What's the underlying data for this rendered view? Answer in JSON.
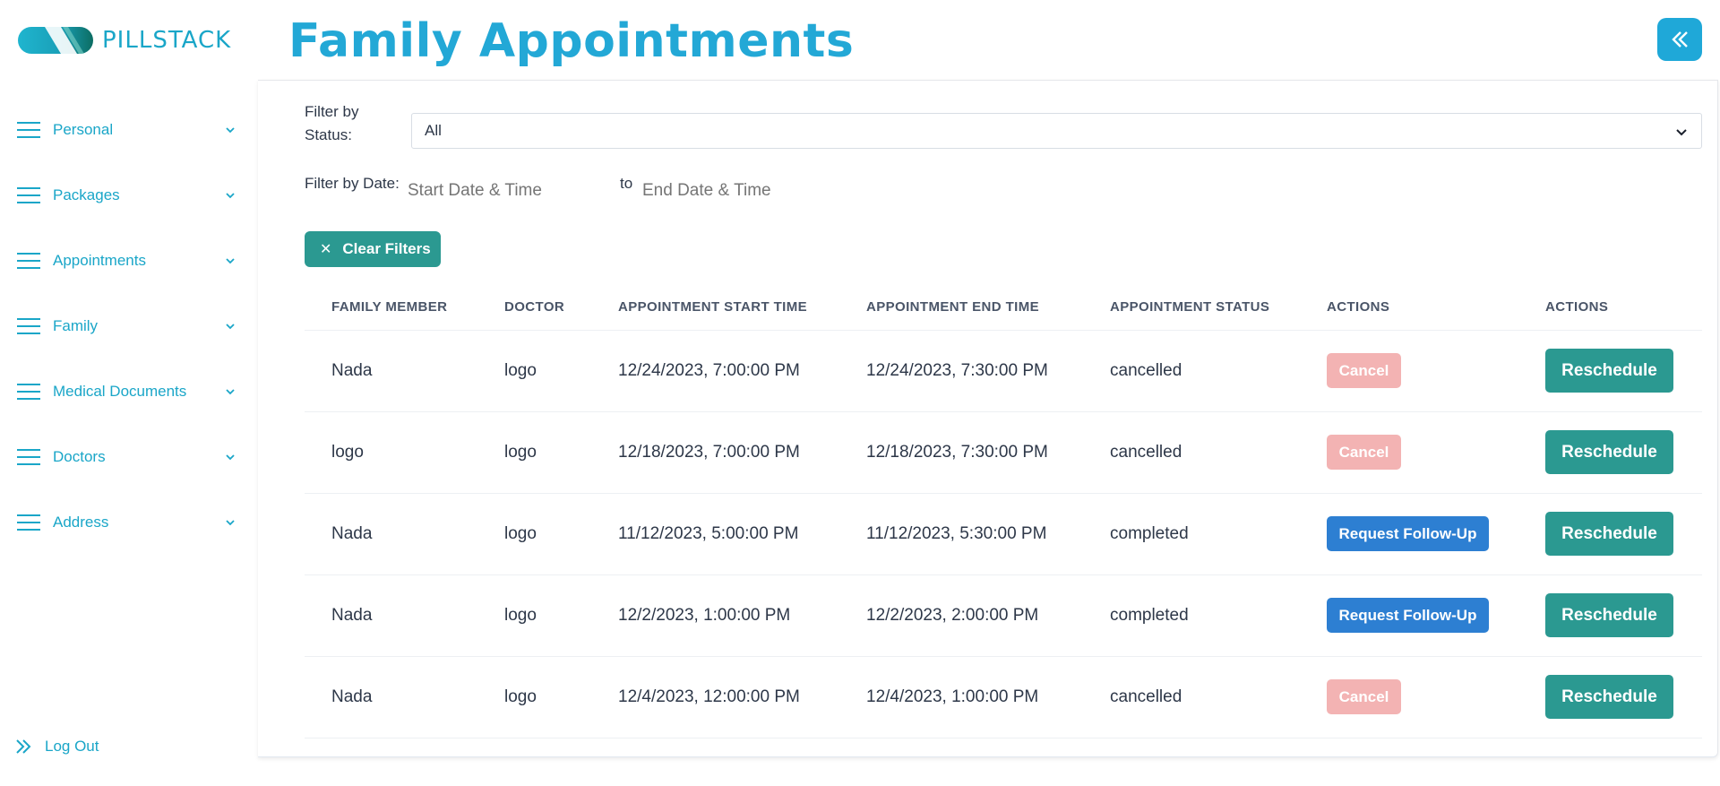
{
  "brand": {
    "name": "PILLSTACK",
    "logo_icon": "pill-logo-icon"
  },
  "sidebar": {
    "items": [
      {
        "label": "Personal",
        "icon": "menu-icon"
      },
      {
        "label": "Packages",
        "icon": "menu-icon"
      },
      {
        "label": "Appointments",
        "icon": "menu-icon"
      },
      {
        "label": "Family",
        "icon": "menu-icon"
      },
      {
        "label": "Medical Documents",
        "icon": "menu-icon"
      },
      {
        "label": "Doctors",
        "icon": "menu-icon"
      },
      {
        "label": "Address",
        "icon": "menu-icon"
      }
    ],
    "logout_label": "Log Out"
  },
  "header": {
    "title": "Family Appointments",
    "collapse_icon": "double-chevron-left-icon"
  },
  "filters": {
    "status_label": "Filter by Status:",
    "status_value": "All",
    "date_label": "Filter by Date:",
    "start_placeholder": "Start Date & Time",
    "to_label": "to",
    "end_placeholder": "End Date & Time",
    "clear_label": "Clear Filters"
  },
  "table": {
    "columns": [
      "Family Member",
      "Doctor",
      "Appointment Start Time",
      "Appointment End Time",
      "Appointment Status",
      "Actions",
      "Actions"
    ],
    "rows": [
      {
        "member": "Nada",
        "doctor": "logo",
        "start": "12/24/2023, 7:00:00 PM",
        "end": "12/24/2023, 7:30:00 PM",
        "status": "cancelled",
        "action": "Cancel",
        "action_type": "cancel",
        "reschedule": "Reschedule"
      },
      {
        "member": "logo",
        "doctor": "logo",
        "start": "12/18/2023, 7:00:00 PM",
        "end": "12/18/2023, 7:30:00 PM",
        "status": "cancelled",
        "action": "Cancel",
        "action_type": "cancel",
        "reschedule": "Reschedule"
      },
      {
        "member": "Nada",
        "doctor": "logo",
        "start": "11/12/2023, 5:00:00 PM",
        "end": "11/12/2023, 5:30:00 PM",
        "status": "completed",
        "action": "Request Follow-Up",
        "action_type": "follow",
        "reschedule": "Reschedule"
      },
      {
        "member": "Nada",
        "doctor": "logo",
        "start": "12/2/2023, 1:00:00 PM",
        "end": "12/2/2023, 2:00:00 PM",
        "status": "completed",
        "action": "Request Follow-Up",
        "action_type": "follow",
        "reschedule": "Reschedule"
      },
      {
        "member": "Nada",
        "doctor": "logo",
        "start": "12/4/2023, 12:00:00 PM",
        "end": "12/4/2023, 1:00:00 PM",
        "status": "cancelled",
        "action": "Cancel",
        "action_type": "cancel",
        "reschedule": "Reschedule"
      }
    ]
  },
  "colors": {
    "brand": "#1aa6c8",
    "title": "#23a8d6",
    "teal_button": "#2b9991",
    "cancel_button": "#f3b3b3",
    "followup_button": "#2d7fd2"
  }
}
